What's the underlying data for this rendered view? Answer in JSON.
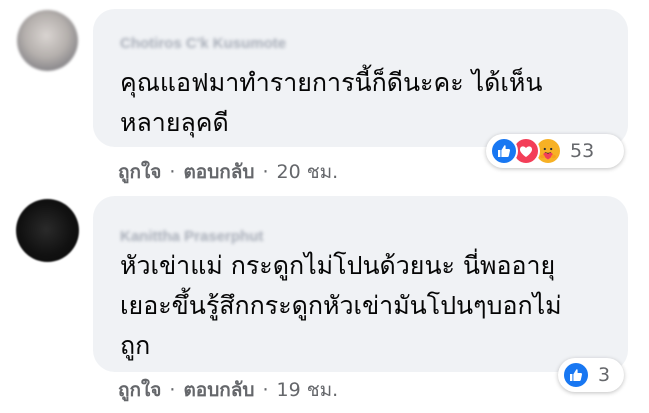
{
  "comments": [
    {
      "author": "Chotiros C'k Kusumote",
      "text": "คุณแอฟมาทำรายการนี้ก็ดีนะคะ ได้เห็น\nหลายลุคดี",
      "like_label": "ถูกใจ",
      "reply_label": "ตอบกลับ",
      "separator": "·",
      "time": "20 ชม.",
      "reaction_count": "53",
      "reaction_icons": [
        "like-icon",
        "love-icon",
        "care-icon"
      ]
    },
    {
      "author": "Kanittha Praserphut",
      "text": "หัวเข่าแม่ กระดูกไม่โปนด้วยนะ นี่พออายุ\nเยอะขึ้นรู้สึกกระดูกหัวเข่ามันโปนๆบอกไม่\nถูก",
      "like_label": "ถูกใจ",
      "reply_label": "ตอบกลับ",
      "separator": "·",
      "time": "19 ชม.",
      "reaction_count": "3",
      "reaction_icons": [
        "like-icon"
      ]
    }
  ],
  "colors": {
    "bubble": "#f0f2f5",
    "text": "#050505",
    "meta": "#65676b",
    "like_blue": "#1877f2",
    "love_red": "#f33e58",
    "care_yellow": "#f7b125"
  }
}
